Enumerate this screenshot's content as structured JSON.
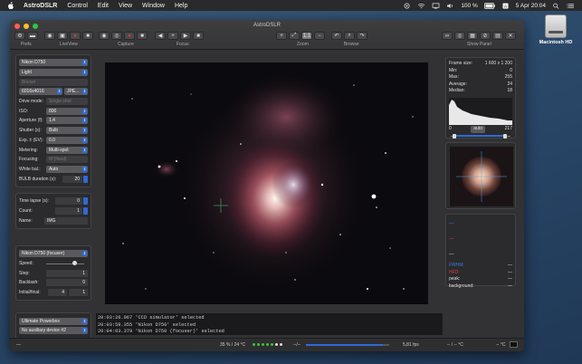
{
  "menubar": {
    "app": "AstroDSLR",
    "items": [
      "Control",
      "Edit",
      "View",
      "Window",
      "Help"
    ],
    "battery": "100 %",
    "datetime": "5 Apr  20:04"
  },
  "desktop": {
    "disk_label": "Macintosh HD"
  },
  "window": {
    "title": "AstroDSLR",
    "toolbar_labels": {
      "prefs": "Prefs",
      "liveview": "LiveView",
      "capture": "Capture",
      "focus": "Focus",
      "zoom": "Zoom",
      "browse": "Browse",
      "show_panel": "Show Panel"
    }
  },
  "camera": {
    "model": "Nikon D750",
    "frame_type": "Light",
    "bin_placeholder": "Bin/set",
    "resolution": "6016x4016",
    "format": "JPE...",
    "drive_mode_label": "Drive mode:",
    "drive_mode_value": "Single shot",
    "iso_label": "ISO:",
    "iso_value": "800",
    "aperture_label": "Aperture (f):",
    "aperture_value": "1.4",
    "shutter_label": "Shutter (s):",
    "shutter_value": "Bulb",
    "exp_label": "Exp. ± (EV):",
    "exp_value": "0.0",
    "metering_label": "Metering:",
    "metering_value": "Multi-spot",
    "focusing_label": "Focusing:",
    "focusing_value": "M (fixed)",
    "wb_label": "White bal.:",
    "wb_value": "Auto",
    "bulb_label": "BULB duration (s):",
    "bulb_value": "20"
  },
  "timelapse": {
    "time_lapse_label": "Time lapse (s):",
    "time_lapse_value": "0",
    "count_label": "Count:",
    "count_value": "1",
    "name_label": "Name:",
    "name_value": "IMG"
  },
  "focuser": {
    "model": "Nikon D750 (focuser)",
    "speed_label": "Speed:",
    "speed_fraction": 0.75,
    "step_label": "Step:",
    "step_value": "1",
    "backlash_label": "Backlash:",
    "backlash_value": "0",
    "initial_final_label": "Initial/final:",
    "initial_value": "4",
    "final_value": "1"
  },
  "aux": {
    "device1": "Ultimate Powerbox",
    "device2": "No auxiliary device #2"
  },
  "log": [
    "20:03:26.067 'CCD simulator' selected",
    "20:03:58.355 'Nikon D750' selected",
    "20:04:03.379 'Nikon D750 (focuser)' selected"
  ],
  "stats": {
    "frame_size_label": "Frame size:",
    "frame_size_value": "1 600 x 1 200",
    "min_label": "Min:",
    "min_value": "0",
    "max_label": "Max:",
    "max_value": "255",
    "average_label": "Average:",
    "average_value": "24",
    "median_label": "Median:",
    "median_value": "18",
    "histo_low": "0",
    "histo_high": "217",
    "stretch_button": "auto",
    "stretch_low": 0.08,
    "stretch_high": 0.88
  },
  "fwhm": {
    "fwhm_label": "FWHM:",
    "fwhm_value": "—",
    "hfd_label": "HFD:",
    "hfd_value": "—",
    "peak_label": "peak:",
    "peak_value": "—",
    "background_label": "background:",
    "background_value": "—",
    "colors": {
      "fwhm": "#3b7ae0",
      "hfd": "#e04040"
    }
  },
  "status": {
    "temp": "35 % / 24 °C",
    "coords": "--/--",
    "fps": "5,81 fps",
    "cooler": "-- / -- °C",
    "ccd_temp": "-- °C",
    "progress": 0.92
  }
}
